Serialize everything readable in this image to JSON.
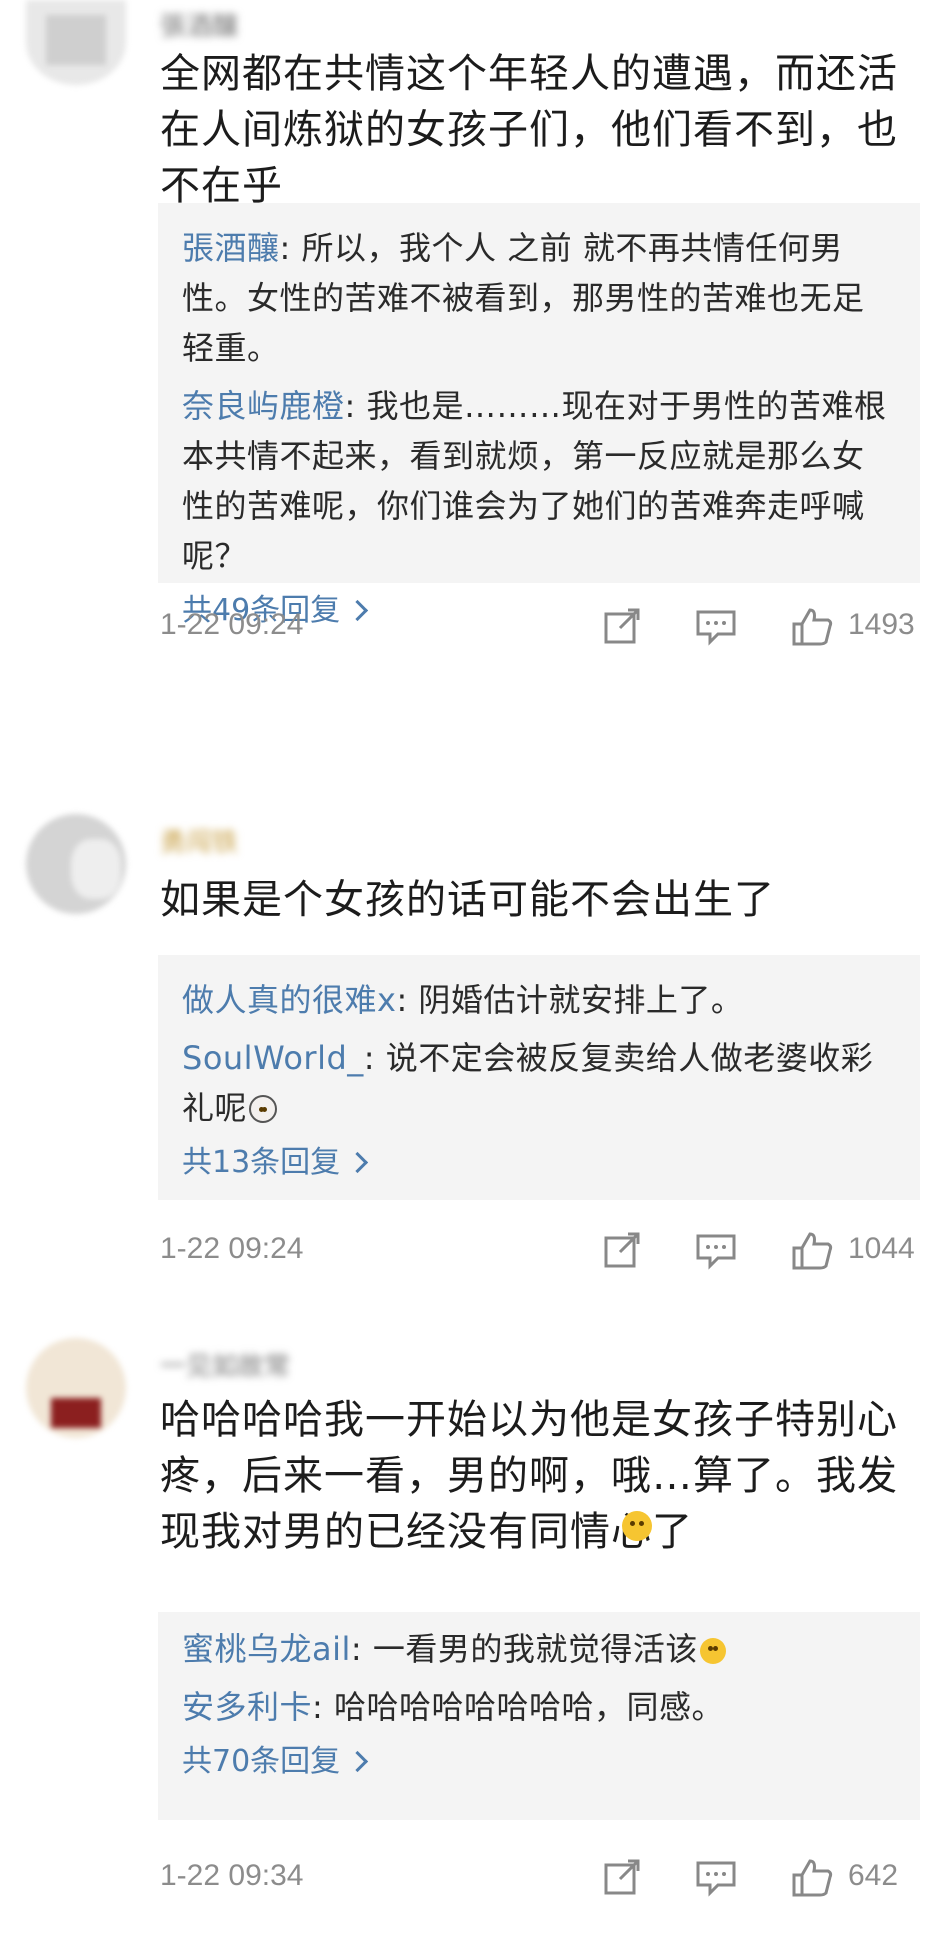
{
  "comments": [
    {
      "username": "張酒釀",
      "text": "全网都在共情这个年轻人的遭遇，而还活在人间炼狱的女孩子们，他们看不到，也不在乎",
      "replies": [
        {
          "name": "張酒釀",
          "text": "所以，我个人 之前 就不再共情任何男性。女性的苦难不被看到，那男性的苦难也无足轻重。"
        },
        {
          "name": "奈良屿鹿橙",
          "text": "我也是………现在对于男性的苦难根本共情不起来，看到就烦，第一反应就是那么女性的苦难呢，你们谁会为了她们的苦难奔走呼喊呢？"
        }
      ],
      "more_replies": "共49条回复",
      "time": "1-22 09:24",
      "likes": "1493"
    },
    {
      "username": "勇闯铁",
      "text": "如果是个女孩的话可能不会出生了",
      "replies": [
        {
          "name": "做人真的很难x",
          "text": "阴婚估计就安排上了。"
        },
        {
          "name": "SoulWorld_",
          "text": "说不定会被反复卖给人做老婆收彩礼呢"
        }
      ],
      "more_replies": "共13条回复",
      "time": "1-22 09:24",
      "likes": "1044"
    },
    {
      "username": "一见如故常",
      "text": "哈哈哈哈我一开始以为他是女孩子特别心疼，后来一看，男的啊，哦…算了。我发现我对男的已经没有同情心了",
      "replies": [
        {
          "name": "蜜桃乌龙ail",
          "text": "一看男的我就觉得活该"
        },
        {
          "name": "安多利卡",
          "text": "哈哈哈哈哈哈哈哈，同感。"
        }
      ],
      "more_replies": "共70条回复",
      "time": "1-22 09:34",
      "likes": "642"
    }
  ],
  "icons": {
    "share": "share-icon",
    "reply": "comment-icon",
    "like": "thumbs-up-icon"
  },
  "colors": {
    "reply_name": "#4d7cad",
    "reply_bg": "#f4f4f4",
    "meta": "#8c8c8c"
  }
}
